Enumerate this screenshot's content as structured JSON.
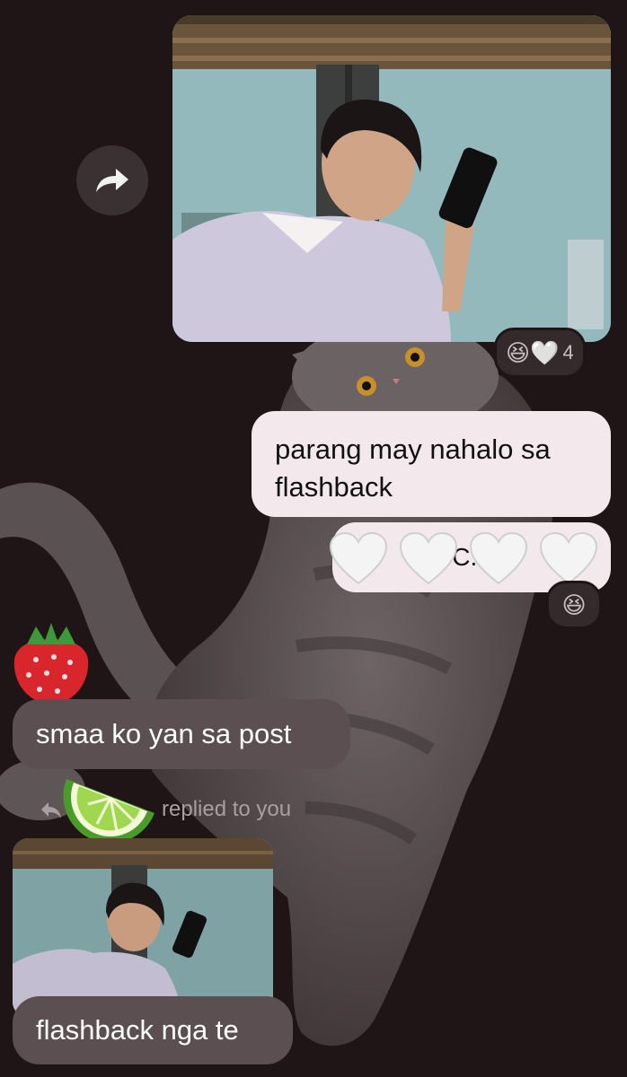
{
  "chat": {
    "messages": [
      {
        "text": "parang may nahalo sa flashback"
      },
      {
        "text": "C..."
      },
      {
        "text": "smaa ko yan sa post"
      },
      {
        "text": "flashback nga te"
      }
    ],
    "reactions_1": {
      "emojis": "😆🤍",
      "count": "4"
    },
    "reactions_2": {
      "emojis": "😆"
    },
    "reply_label": "replied to you"
  },
  "icons": {
    "forward": "share-forward-icon",
    "reply": "reply-arrow-icon",
    "avatar_1": "strawberry-icon",
    "avatar_2": "lime-icon"
  }
}
